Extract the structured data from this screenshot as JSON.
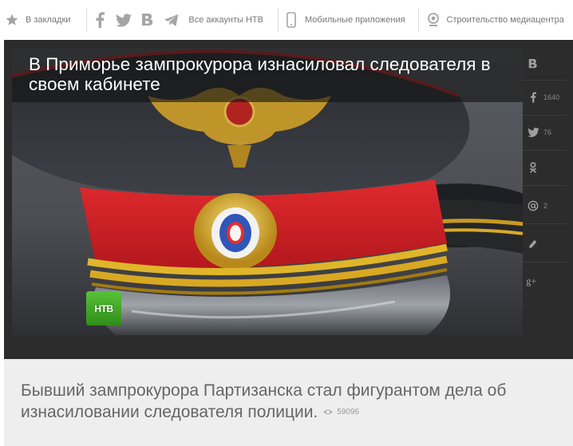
{
  "topbar": {
    "bookmarks_label": "В закладки",
    "all_accounts_label": "Все аккаунты НТВ",
    "mobile_apps_label": "Мобильные приложения",
    "media_center_label": "Строительство медиацентра"
  },
  "article": {
    "headline": "В Приморье зампрокурора изнасиловал следователя в своем кабинете",
    "lead": "Бывший зампрокурора Партизанска стал фигурантом дела об изнасиловании следователя полиции.",
    "views": "59096",
    "logo_text": "НТВ"
  },
  "share": {
    "vk_count": "",
    "facebook_count": "1640",
    "twitter_count": "76",
    "odnoklassniki_count": "",
    "mailru_count": "2",
    "livejournal_count": "",
    "googleplus_count": ""
  },
  "colors": {
    "ntv_green": "#3fa222",
    "cap_red": "#d8242a",
    "gold": "#e0b52a"
  }
}
